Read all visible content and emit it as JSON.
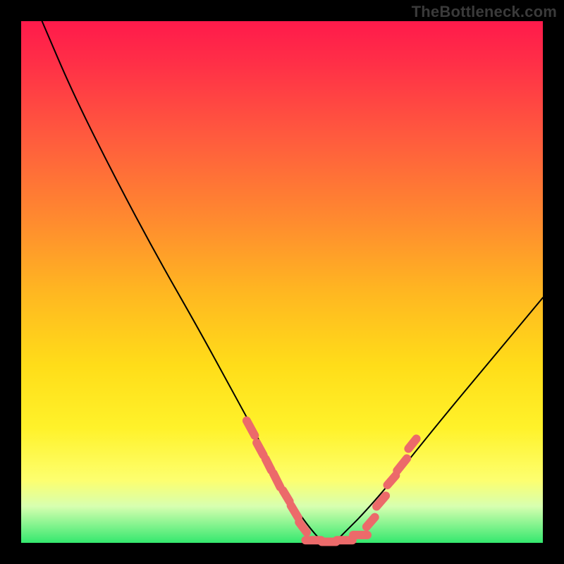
{
  "watermark": "TheBottleneck.com",
  "chart_data": {
    "type": "line",
    "title": "",
    "xlabel": "",
    "ylabel": "",
    "xlim": [
      0,
      100
    ],
    "ylim": [
      0,
      100
    ],
    "grid": false,
    "description": "V-shaped bottleneck curve over a vertical red→green heat gradient. Minimum (≈0) near x≈58; left arm rises to ≈100 at x≈4; right arm rises to ≈47 at x=100.",
    "series": [
      {
        "name": "bottleneck-curve",
        "x": [
          4,
          10,
          18,
          26,
          34,
          40,
          46,
          50,
          53,
          56,
          58,
          60,
          62,
          66,
          72,
          80,
          90,
          100
        ],
        "values": [
          100,
          86,
          70,
          55,
          41,
          30,
          19,
          11,
          6,
          2,
          0,
          0,
          2,
          6,
          13,
          23,
          35,
          47
        ]
      }
    ],
    "highlight_dashes": {
      "comment": "Salmon tick segments near the valley; x in domain units, y in value units, len along curve direction in px.",
      "left_arm": [
        {
          "x": 44.0,
          "y": 22,
          "len": 24
        },
        {
          "x": 45.8,
          "y": 18,
          "len": 20
        },
        {
          "x": 47.4,
          "y": 15,
          "len": 18
        },
        {
          "x": 49.0,
          "y": 12,
          "len": 22
        },
        {
          "x": 50.8,
          "y": 9,
          "len": 18
        },
        {
          "x": 52.4,
          "y": 6,
          "len": 20
        },
        {
          "x": 54.0,
          "y": 3,
          "len": 18
        }
      ],
      "bottom": [
        {
          "x": 56.0,
          "y": 0.5,
          "len": 22
        },
        {
          "x": 59.0,
          "y": 0.2,
          "len": 20
        },
        {
          "x": 62.0,
          "y": 0.5,
          "len": 22
        },
        {
          "x": 65.0,
          "y": 1.5,
          "len": 20
        }
      ],
      "right_arm": [
        {
          "x": 67.0,
          "y": 4,
          "len": 18
        },
        {
          "x": 69.0,
          "y": 8,
          "len": 20
        },
        {
          "x": 71.0,
          "y": 12,
          "len": 18
        },
        {
          "x": 73.0,
          "y": 15,
          "len": 22
        },
        {
          "x": 75.0,
          "y": 19,
          "len": 18
        }
      ]
    }
  }
}
